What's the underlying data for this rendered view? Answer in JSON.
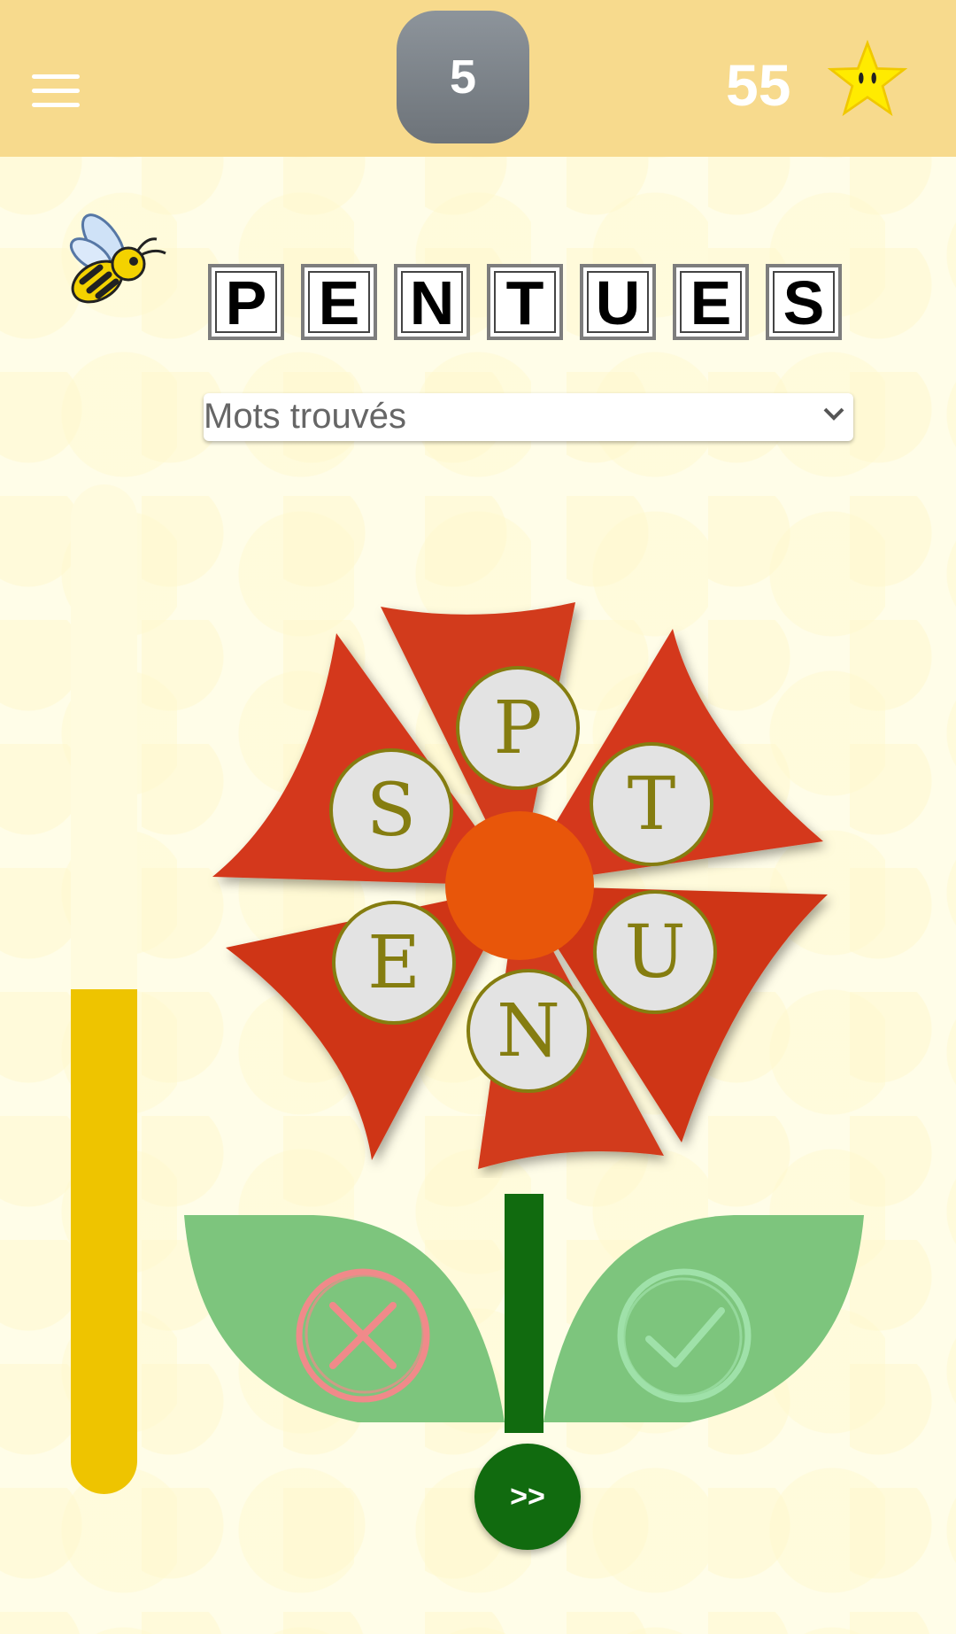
{
  "header": {
    "menu_icon": "hamburger-menu-icon",
    "level": "5",
    "score": "55",
    "score_icon": "star-icon"
  },
  "puzzle": {
    "word_letters": [
      "P",
      "E",
      "N",
      "T",
      "U",
      "E",
      "S"
    ],
    "found_words_placeholder": "Mots trouvés",
    "progress": 0.5
  },
  "flower": {
    "center_color": "#e8560a",
    "petal_color": "#d23a1e",
    "tiles": [
      "P",
      "T",
      "U",
      "N",
      "E",
      "S"
    ]
  },
  "controls": {
    "reject_icon": "cross-icon",
    "accept_icon": "check-icon",
    "next_label": ">>"
  },
  "colors": {
    "header_bg": "#f7da8d",
    "progress_fill": "#eec400",
    "progress_track": "#fffbde",
    "leaf": "#7dc57d",
    "stem": "#116b0f"
  }
}
